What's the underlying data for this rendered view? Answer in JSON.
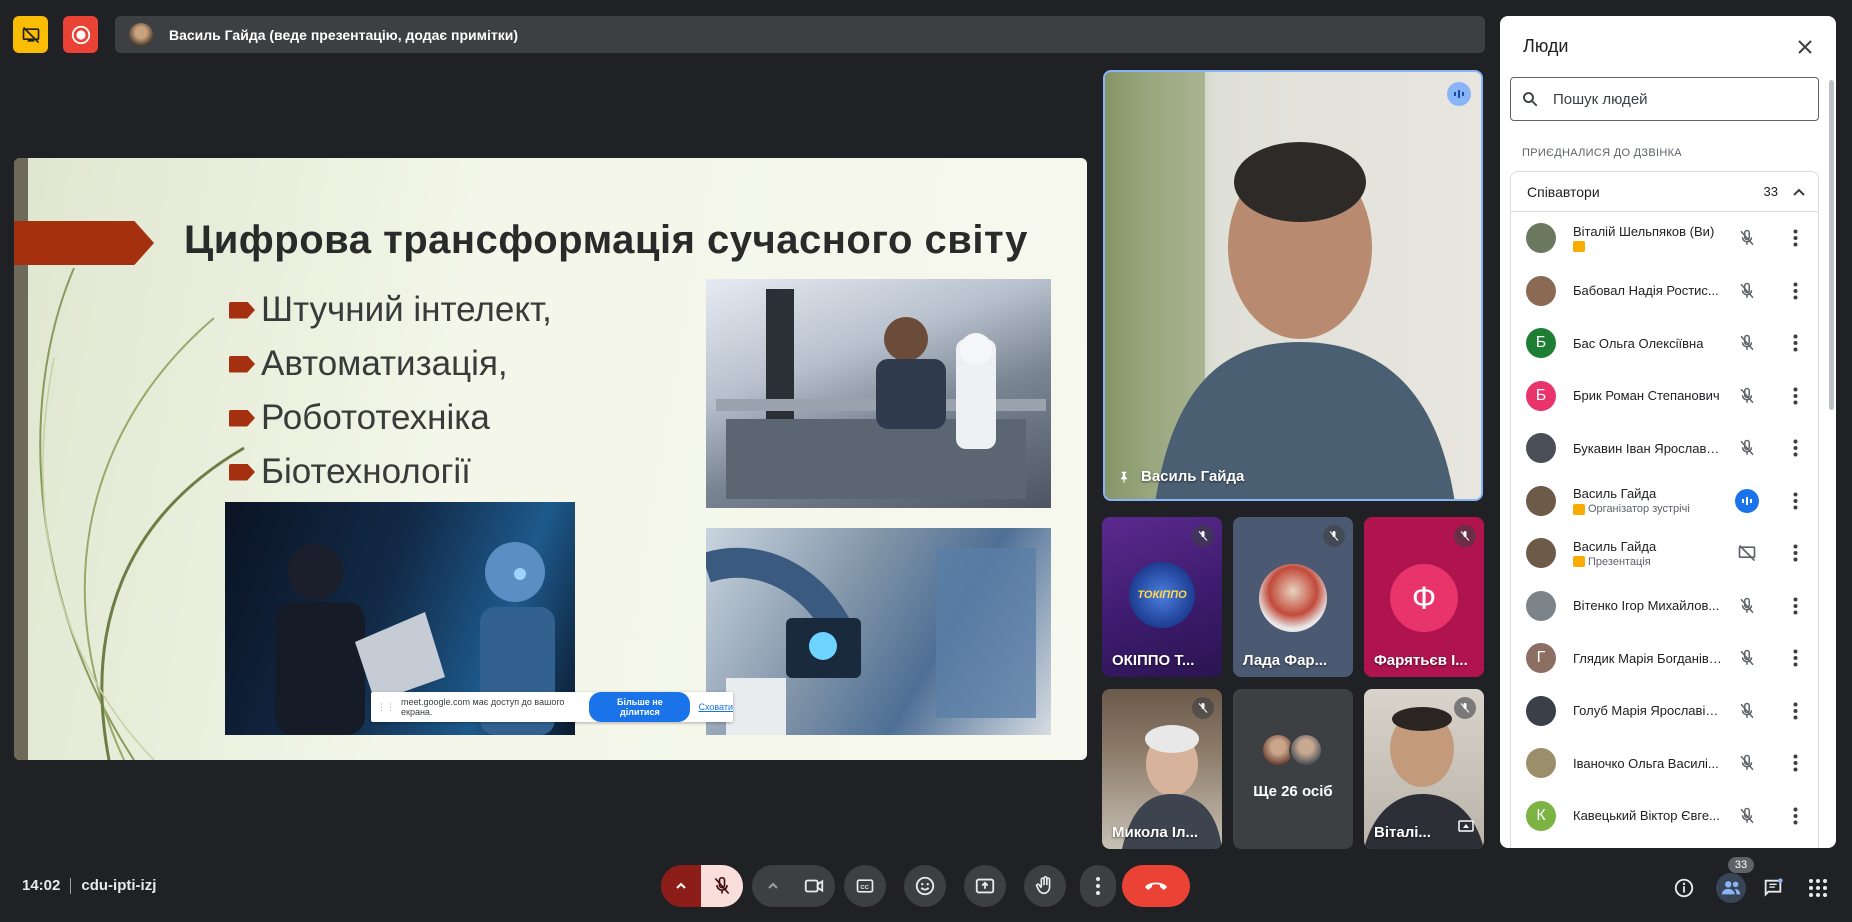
{
  "topbar": {
    "presenter_banner": "Василь Гайда (веде презентацію, додає примітки)"
  },
  "slide": {
    "title": "Цифрова трансформація сучасного світу",
    "bullets": [
      "Штучний інтелект,",
      "Автоматизація,",
      "Робототехніка",
      "Біотехнології"
    ],
    "share_bar": {
      "message": "meet.google.com має доступ до вашого екрана.",
      "stop_label": "Більше не ділитися",
      "hide_label": "Сховати"
    }
  },
  "tiles": {
    "main_speaker_name": "Василь Гайда",
    "small": [
      {
        "name": "ОКІППО Т...",
        "logo_text": "ТОКІППО"
      },
      {
        "name": "Лада Фар..."
      },
      {
        "name": "Фарятьєв І...",
        "initial": "Ф"
      },
      {
        "name": "Микола Іл..."
      },
      {
        "name": "Ще 26 осіб"
      },
      {
        "name": "Віталі..."
      }
    ]
  },
  "panel": {
    "title": "Люди",
    "search_placeholder": "Пошук людей",
    "section_label": "ПРИЄДНАЛИСЯ ДО ДЗВІНКА",
    "group_label": "Співавтори",
    "group_count": "33",
    "people": [
      {
        "name": "Віталій Шельпяков (Ви)",
        "sub": "",
        "tag": true,
        "avatar_color": "#6b7a5e",
        "initial": ""
      },
      {
        "name": "Бабовал Надія Ростис...",
        "sub": "",
        "tag": false,
        "avatar_color": "#8a6a52",
        "initial": ""
      },
      {
        "name": "Бас Ольга Олексіївна",
        "sub": "",
        "tag": false,
        "avatar_color": "#1e7e34",
        "initial": "Б"
      },
      {
        "name": "Брик Роман Степанович",
        "sub": "",
        "tag": false,
        "avatar_color": "#e8336b",
        "initial": "Б"
      },
      {
        "name": "Букавин Іван Ярославо...",
        "sub": "",
        "tag": false,
        "avatar_color": "#4b4f57",
        "initial": ""
      },
      {
        "name": "Василь Гайда",
        "sub": "Організатор зустрічі",
        "tag": true,
        "avatar_color": "#6d5a48",
        "initial": ""
      },
      {
        "name": "Василь Гайда",
        "sub": "Презентація",
        "tag": true,
        "avatar_color": "#6d5a48",
        "initial": ""
      },
      {
        "name": "Вітенко Ігор Михайлов...",
        "sub": "",
        "tag": false,
        "avatar_color": "#7c8489",
        "initial": ""
      },
      {
        "name": "Глядик Марія Богданівна",
        "sub": "",
        "tag": false,
        "avatar_color": "#8d6e63",
        "initial": "Г"
      },
      {
        "name": "Голуб Марія Ярославів...",
        "sub": "",
        "tag": false,
        "avatar_color": "#3b3f4a",
        "initial": ""
      },
      {
        "name": "Іваночко Ольга Василі...",
        "sub": "",
        "tag": false,
        "avatar_color": "#9a8f6a",
        "initial": ""
      },
      {
        "name": "Кавецький Віктор Євге...",
        "sub": "",
        "tag": false,
        "avatar_color": "#7cb342",
        "initial": "К"
      }
    ]
  },
  "bottombar": {
    "time": "14:02",
    "meeting_code": "cdu-ipti-izj",
    "people_count": "33"
  },
  "colors": {
    "background": "#202124",
    "end_call": "#ea4335",
    "mic_off_bg": "#f9dedc",
    "accent_blue": "#8ab4f8",
    "record": "#ea4335",
    "present_icon": "#fbbc04"
  }
}
